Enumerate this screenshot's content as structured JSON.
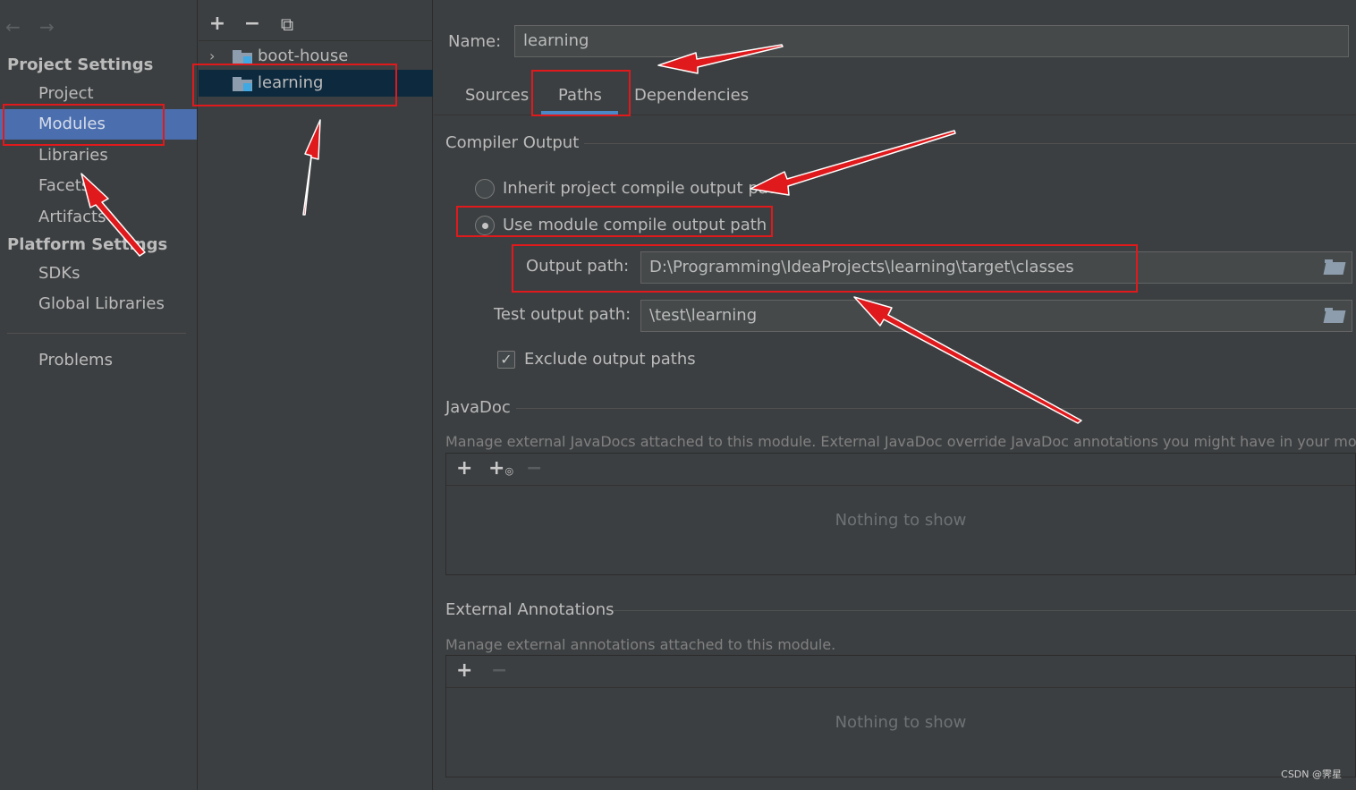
{
  "sidebar": {
    "nav_back": "←",
    "nav_forward": "→",
    "project_settings_title": "Project Settings",
    "project_items": [
      "Project",
      "Modules",
      "Libraries",
      "Facets",
      "Artifacts"
    ],
    "selected_item": "Modules",
    "platform_settings_title": "Platform Settings",
    "platform_items": [
      "SDKs",
      "Global Libraries"
    ],
    "problems": "Problems"
  },
  "tree": {
    "toolbar": {
      "add": "+",
      "remove": "−",
      "copy": "⧉"
    },
    "modules": [
      {
        "label": "boot-house",
        "expandable": true
      },
      {
        "label": "learning",
        "expandable": false
      }
    ],
    "selected_module": "learning"
  },
  "main": {
    "name_label": "Name:",
    "name_value": "learning",
    "tabs": [
      "Sources",
      "Paths",
      "Dependencies"
    ],
    "active_tab": "Paths",
    "compiler_output": {
      "title": "Compiler Output",
      "inherit_option": "Inherit project compile output path",
      "module_option": "Use module compile output path",
      "selected_option": "module",
      "output_path_label": "Output path:",
      "output_path_value": "D:\\Programming\\IdeaProjects\\learning\\target\\classes",
      "test_output_path_label": "Test output path:",
      "test_output_path_value": "\\test\\learning",
      "exclude_label": "Exclude output paths",
      "exclude_checked": true
    },
    "javadoc": {
      "title": "JavaDoc",
      "description": "Manage external JavaDocs attached to this module. External JavaDoc override JavaDoc annotations you might have in your module.",
      "empty_text": "Nothing to show"
    },
    "external_annotations": {
      "title": "External Annotations",
      "description": "Manage external annotations attached to this module.",
      "empty_text": "Nothing to show"
    }
  },
  "watermark": "CSDN @霁星",
  "colors": {
    "annotation": "#e0191c",
    "selection_sidebar": "#4b6eaf",
    "selection_tree": "#0d293e",
    "tab_underline": "#4a88c7",
    "background": "#3c3f41"
  }
}
